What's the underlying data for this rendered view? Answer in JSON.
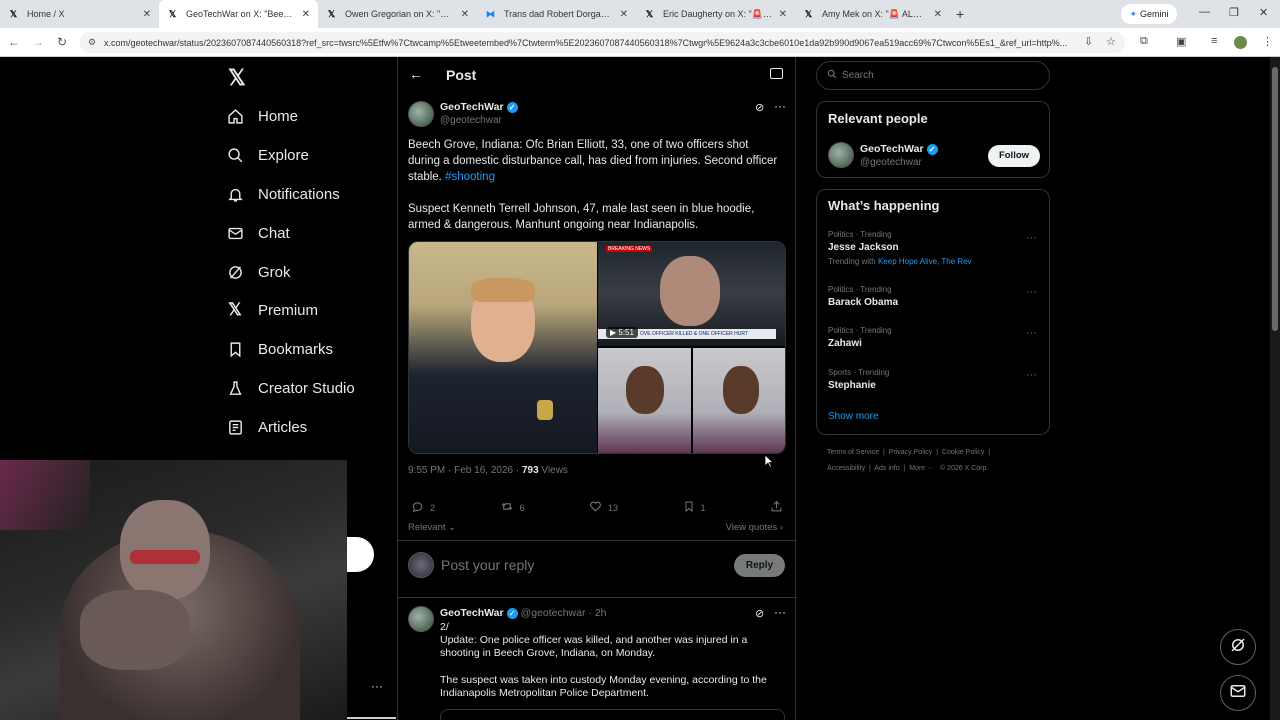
{
  "browser": {
    "tabs": [
      {
        "title": "Home / X",
        "icon": "x-logo-icon"
      },
      {
        "title": "GeoTechWar on X: \"Beech Grov",
        "icon": "x-logo-icon"
      },
      {
        "title": "Owen Gregorian on X: \"BREAKI",
        "icon": "x-logo-icon"
      },
      {
        "title": "Trans dad Robert Dorgan shoot",
        "icon": "butterfly-icon"
      },
      {
        "title": "Eric Daugherty on X: \"🚨 BREA",
        "icon": "x-logo-icon"
      },
      {
        "title": "Amy Mek on X: \"🚨 ALERT TEXA",
        "icon": "x-logo-icon"
      }
    ],
    "gemini_label": "Gemini",
    "url": "x.com/geotechwar/status/2023607087440560318?ref_src=twsrc%5Etfw%7Ctwcamp%5Etweetembed%7Ctwterm%5E2023607087440560318%7Ctwgr%5E9624a3c3cbe6010e1da92b990d9067ea519acc69%7Ctwcon%5Es1_&ref_url=http%..."
  },
  "leftnav": {
    "items": [
      {
        "label": "Home",
        "icon": "home-icon"
      },
      {
        "label": "Explore",
        "icon": "search-icon"
      },
      {
        "label": "Notifications",
        "icon": "bell-icon"
      },
      {
        "label": "Chat",
        "icon": "mail-icon"
      },
      {
        "label": "Grok",
        "icon": "grok-icon"
      },
      {
        "label": "Premium",
        "icon": "x-logo-icon"
      },
      {
        "label": "Bookmarks",
        "icon": "bookmark-icon"
      },
      {
        "label": "Creator Studio",
        "icon": "creator-icon"
      },
      {
        "label": "Articles",
        "icon": "articles-icon"
      }
    ]
  },
  "post": {
    "header_title": "Post",
    "author_name": "GeoTechWar",
    "author_handle": "@geotechwar",
    "text1": "Beech Grove, Indiana: Ofc Brian Elliott, 33, one of two officers shot during a domestic disturbance call, has died from injuries. Second officer stable.",
    "hashtag": "#shooting",
    "text2": "Suspect Kenneth Terrell Johnson, 47, male last seen in blue hoodie, armed & dangerous. Manhunt ongoing near Indianapolis.",
    "video_duration": "5:51",
    "video_banner": "BREAKING NEWS",
    "video_lower_third": "OVE OFFICER KILLED & ONE OFFICER HURT",
    "timestamp": "9:55 PM · Feb 16, 2026 ·",
    "views_count": "793",
    "views_label": "Views",
    "replies": "2",
    "reposts": "6",
    "likes": "13",
    "bookmarks": "1",
    "sort_label": "Relevant",
    "view_quotes": "View quotes",
    "reply_placeholder": "Post your reply",
    "reply_button": "Reply"
  },
  "reply_tweet": {
    "author_name": "GeoTechWar",
    "author_handle": "@geotechwar",
    "time": "· 2h",
    "line1": "2/",
    "line2": "Update: One police officer was killed, and another was injured in a shooting in Beech Grove, Indiana, on Monday.",
    "line3": "The suspect was taken into custody Monday evening, according to the Indianapolis Metropolitan Police Department."
  },
  "sidebar": {
    "search_placeholder": "Search",
    "relevant_title": "Relevant people",
    "person_name": "GeoTechWar",
    "person_handle": "@geotechwar",
    "follow_label": "Follow",
    "happening_title": "What’s happening",
    "trends": [
      {
        "category": "Politics · Trending",
        "name": "Jesse Jackson",
        "with_label": "Trending with",
        "with_links": "Keep Hope Alive, The Rev"
      },
      {
        "category": "Politics · Trending",
        "name": "Barack Obama"
      },
      {
        "category": "Politics · Trending",
        "name": "Zahawi"
      },
      {
        "category": "Sports · Trending",
        "name": "Stephanie"
      }
    ],
    "show_more": "Show more",
    "footer": {
      "terms": "Terms of Service",
      "privacy": "Privacy Policy",
      "cookie": "Cookie Policy",
      "accessibility": "Accessibility",
      "ads": "Ads info",
      "more": "More ···",
      "copyright": "© 2026 X Corp."
    }
  },
  "colors": {
    "accent": "#1d9bf0",
    "bg": "#000000",
    "border": "#2f3336",
    "muted": "#71767b"
  }
}
